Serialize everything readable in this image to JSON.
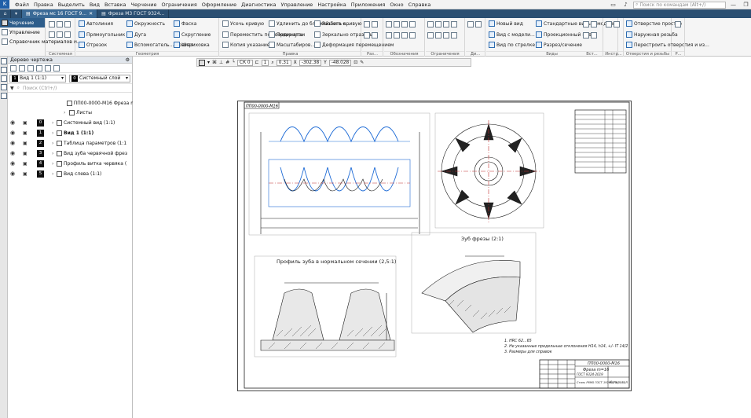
{
  "menu": [
    "Файл",
    "Правка",
    "Выделить",
    "Вид",
    "Вставка",
    "Черчение",
    "Ограничения",
    "Оформление",
    "Диагностика",
    "Управление",
    "Настройка",
    "Приложения",
    "Окно",
    "Справка"
  ],
  "search_placeholder": "Поиск по командам (Alt+/)",
  "tabs": [
    {
      "label": "Фреза мс 16 ГОСТ 9...",
      "active": true
    },
    {
      "label": "Фреза М3 ГОСТ 9324...",
      "active": false
    }
  ],
  "ribbon_left": [
    "Черчение",
    "Управление",
    "Справочник материалов и..."
  ],
  "ribbon_groups": {
    "system": {
      "label": "Системная"
    },
    "geometry": {
      "label": "Геометрия",
      "items": [
        "Автолиния",
        "Окружность",
        "Фаска",
        "Прямоугольник",
        "Дуга",
        "Скругление",
        "Отрезок",
        "Вспомогатель... прямая",
        "Штриховка"
      ]
    },
    "edit": {
      "label": "Правка",
      "items": [
        "Усечь кривую",
        "Удлинить до ближайшего о...",
        "Разбить кривую",
        "Переместить по координатам",
        "Повернуть",
        "Зеркально отразить",
        "Копия указанием",
        "Масштабиров...",
        "Деформация перемещением"
      ]
    },
    "dims": {
      "label": "Раз..."
    },
    "marks": {
      "label": "Обозначения"
    },
    "constraints": {
      "label": "Ограничения"
    },
    "dia": {
      "label": "Ди..."
    },
    "views": {
      "label": "Виды",
      "items": [
        "Новый вид",
        "Стандартные виды с модели...",
        "Вид с модели...",
        "Проекционный вид",
        "Вид по стрелке",
        "Разрез/сечение"
      ]
    },
    "vst": {
      "label": "Вст..."
    },
    "instr": {
      "label": "Инстр..."
    },
    "holes": {
      "label": "Отверстия и резьбы",
      "items": [
        "Отверстие простое",
        "Наружная резьба",
        "Перестроить отверстия и из..."
      ]
    },
    "r": {
      "label": "Р..."
    }
  },
  "tree": {
    "title": "Дерево чертежа",
    "view_select": "Вид 1 (1:1)",
    "view_num": "1",
    "layer_select": "Системный слой",
    "layer_num": "0",
    "search_placeholder": "Поиск (Ctrl+/)",
    "root": "ПП00-0000-М16 Фреза m",
    "sheets": "Листы",
    "rows": [
      {
        "num": "0",
        "label": "Системный вид (1:1)"
      },
      {
        "num": "1",
        "label": "Вид 1 (1:1)"
      },
      {
        "num": "2",
        "label": "Таблица параметров (1:1"
      },
      {
        "num": "3",
        "label": "Вид зуба червячной фрез"
      },
      {
        "num": "4",
        "label": "Профиль витка червяка ("
      },
      {
        "num": "5",
        "label": "Вид слева (1:1)"
      }
    ]
  },
  "canvas_toolbar": {
    "cs": "СК 0",
    "step": "1",
    "coord_x": "-302.38",
    "coord_y": "-48.028",
    "dx": "0.31"
  },
  "drawing": {
    "stamp": "ПП00-0000-М16",
    "title_block_code": "ПП00-0000-М16",
    "title_block_name": "Фреза m=16",
    "title_block_std": "ГОСТ 9324-2019",
    "title_block_material": "Сталь Р6М5 ГОСТ 19265-73",
    "title_block_org": "Копировал",
    "section_title": "Профиль зуба в нормальном сечении (2,5:1)",
    "tooth_view_title": "Зуб фрезы (2:1)",
    "notes": [
      "1. HRC 62...65",
      "2. Не указанные предельные отклонения Н14, h14, +/- IT 14/2",
      "3. Размеры для справок"
    ]
  }
}
